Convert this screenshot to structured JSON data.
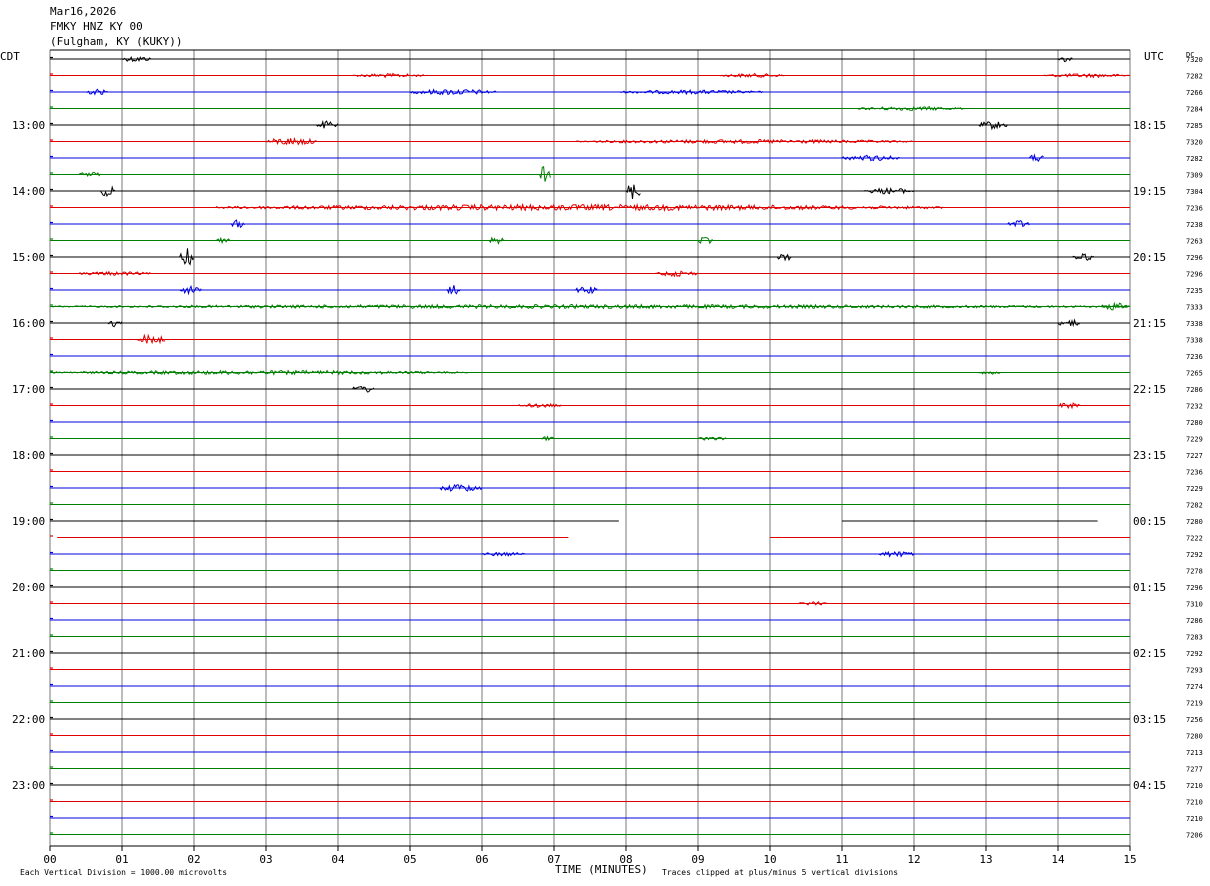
{
  "header": {
    "date": "Mar16,2026",
    "station": "FMKY HNZ KY 00",
    "site": "(Fulgham, KY (KUKY))"
  },
  "chart_data": {
    "type": "line",
    "subtype": "helicorder",
    "left_zone": "CDT",
    "right_zone": "UTC",
    "dc_label": "DC",
    "xlabel": "TIME (MINUTES)",
    "x_ticks": [
      "00",
      "01",
      "02",
      "03",
      "04",
      "05",
      "06",
      "07",
      "08",
      "09",
      "10",
      "11",
      "12",
      "13",
      "14",
      "15"
    ],
    "xlim": [
      0,
      15
    ],
    "scale_note": "Each Vertical Division = 1000.00 microvolts",
    "clip_note": "Traces clipped at plus/minus 5 vertical divisions",
    "trace_colors": [
      "#000000",
      "#e00000",
      "#0000e0",
      "#008000"
    ],
    "left_hour_labels": [
      {
        "row": 4,
        "label": "13:00"
      },
      {
        "row": 8,
        "label": "14:00"
      },
      {
        "row": 12,
        "label": "15:00"
      },
      {
        "row": 16,
        "label": "16:00"
      },
      {
        "row": 20,
        "label": "17:00"
      },
      {
        "row": 24,
        "label": "18:00"
      },
      {
        "row": 28,
        "label": "19:00"
      },
      {
        "row": 32,
        "label": "20:00"
      },
      {
        "row": 36,
        "label": "21:00"
      },
      {
        "row": 40,
        "label": "22:00"
      },
      {
        "row": 44,
        "label": "23:00"
      }
    ],
    "right_hour_labels": [
      {
        "row": 4,
        "label": "18:15"
      },
      {
        "row": 8,
        "label": "19:15"
      },
      {
        "row": 12,
        "label": "20:15"
      },
      {
        "row": 16,
        "label": "21:15"
      },
      {
        "row": 20,
        "label": "22:15"
      },
      {
        "row": 24,
        "label": "23:15"
      },
      {
        "row": 28,
        "label": "00:15"
      },
      {
        "row": 32,
        "label": "01:15"
      },
      {
        "row": 36,
        "label": "02:15"
      },
      {
        "row": 40,
        "label": "03:15"
      },
      {
        "row": 44,
        "label": "04:15"
      }
    ],
    "dc_values": [
      "7320",
      "7282",
      "7266",
      "7284",
      "7285",
      "7320",
      "7282",
      "7309",
      "7304",
      "7236",
      "7238",
      "7263",
      "7296",
      "7296",
      "7235",
      "7333",
      "7338",
      "7338",
      "7236",
      "7265",
      "7286",
      "7232",
      "7280",
      "7229",
      "7227",
      "7236",
      "7229",
      "7282",
      "7280",
      "7222",
      "7292",
      "7278",
      "7296",
      "7310",
      "7286",
      "7283",
      "7292",
      "7293",
      "7274",
      "7219",
      "7256",
      "7280",
      "7213",
      "7277",
      "7210",
      "7210",
      "7210",
      "7206"
    ],
    "trace_events": [
      {
        "row": 0,
        "x0": 1.0,
        "x1": 1.4,
        "amp": 3
      },
      {
        "row": 0,
        "x0": 14.0,
        "x1": 14.2,
        "amp": 3
      },
      {
        "row": 1,
        "x0": 4.2,
        "x1": 5.2,
        "amp": 2
      },
      {
        "row": 1,
        "x0": 9.3,
        "x1": 10.2,
        "amp": 2
      },
      {
        "row": 1,
        "x0": 13.8,
        "x1": 15.0,
        "amp": 2
      },
      {
        "row": 2,
        "x0": 0.5,
        "x1": 0.8,
        "amp": 3
      },
      {
        "row": 2,
        "x0": 5.0,
        "x1": 6.2,
        "amp": 3
      },
      {
        "row": 2,
        "x0": 7.9,
        "x1": 9.9,
        "amp": 2
      },
      {
        "row": 3,
        "x0": 11.2,
        "x1": 12.7,
        "amp": 2
      },
      {
        "row": 4,
        "x0": 3.7,
        "x1": 4.0,
        "amp": 4
      },
      {
        "row": 4,
        "x0": 12.9,
        "x1": 13.3,
        "amp": 4
      },
      {
        "row": 5,
        "x0": 3.0,
        "x1": 3.7,
        "amp": 4
      },
      {
        "row": 5,
        "x0": 7.3,
        "x1": 12.0,
        "amp": 2
      },
      {
        "row": 6,
        "x0": 11.0,
        "x1": 11.8,
        "amp": 3
      },
      {
        "row": 6,
        "x0": 13.6,
        "x1": 13.8,
        "amp": 4
      },
      {
        "row": 7,
        "x0": 0.4,
        "x1": 0.7,
        "amp": 3
      },
      {
        "row": 7,
        "x0": 6.8,
        "x1": 6.95,
        "amp": 9
      },
      {
        "row": 8,
        "x0": 0.7,
        "x1": 0.9,
        "amp": 6
      },
      {
        "row": 8,
        "x0": 8.0,
        "x1": 8.2,
        "amp": 9
      },
      {
        "row": 8,
        "x0": 11.3,
        "x1": 12.0,
        "amp": 3
      },
      {
        "row": 9,
        "x0": 2.3,
        "x1": 12.4,
        "amp": 3
      },
      {
        "row": 10,
        "x0": 2.5,
        "x1": 2.7,
        "amp": 4
      },
      {
        "row": 10,
        "x0": 13.3,
        "x1": 13.6,
        "amp": 4
      },
      {
        "row": 11,
        "x0": 2.3,
        "x1": 2.5,
        "amp": 3
      },
      {
        "row": 11,
        "x0": 6.1,
        "x1": 6.3,
        "amp": 4
      },
      {
        "row": 11,
        "x0": 9.0,
        "x1": 9.2,
        "amp": 4
      },
      {
        "row": 12,
        "x0": 1.8,
        "x1": 2.0,
        "amp": 9
      },
      {
        "row": 12,
        "x0": 10.1,
        "x1": 10.3,
        "amp": 4
      },
      {
        "row": 12,
        "x0": 14.2,
        "x1": 14.5,
        "amp": 4
      },
      {
        "row": 13,
        "x0": 0.4,
        "x1": 1.4,
        "amp": 2
      },
      {
        "row": 13,
        "x0": 8.4,
        "x1": 9.0,
        "amp": 3
      },
      {
        "row": 14,
        "x0": 1.8,
        "x1": 2.1,
        "amp": 4
      },
      {
        "row": 14,
        "x0": 5.5,
        "x1": 5.7,
        "amp": 5
      },
      {
        "row": 14,
        "x0": 7.3,
        "x1": 7.6,
        "amp": 4
      },
      {
        "row": 15,
        "x0": 0.0,
        "x1": 15.0,
        "amp": 2
      },
      {
        "row": 15,
        "x0": 14.6,
        "x1": 15.0,
        "amp": 4
      },
      {
        "row": 16,
        "x0": 0.8,
        "x1": 1.0,
        "amp": 4
      },
      {
        "row": 16,
        "x0": 14.0,
        "x1": 14.3,
        "amp": 4
      },
      {
        "row": 17,
        "x0": 1.2,
        "x1": 1.6,
        "amp": 5
      },
      {
        "row": 19,
        "x0": 0.0,
        "x1": 5.8,
        "amp": 2
      },
      {
        "row": 19,
        "x0": 12.9,
        "x1": 13.2,
        "amp": 2
      },
      {
        "row": 20,
        "x0": 4.2,
        "x1": 4.5,
        "amp": 4
      },
      {
        "row": 21,
        "x0": 6.5,
        "x1": 7.1,
        "amp": 2
      },
      {
        "row": 21,
        "x0": 14.0,
        "x1": 14.3,
        "amp": 3
      },
      {
        "row": 23,
        "x0": 6.8,
        "x1": 7.0,
        "amp": 2
      },
      {
        "row": 23,
        "x0": 9.0,
        "x1": 9.4,
        "amp": 2
      },
      {
        "row": 26,
        "x0": 5.4,
        "x1": 6.0,
        "amp": 4
      },
      {
        "row": 30,
        "x0": 6.0,
        "x1": 6.6,
        "amp": 2
      },
      {
        "row": 30,
        "x0": 11.5,
        "x1": 12.0,
        "amp": 3
      },
      {
        "row": 33,
        "x0": 10.4,
        "x1": 10.8,
        "amp": 2
      }
    ],
    "trace_gaps": [
      {
        "row": 28,
        "x0": 7.9,
        "x1": 11.0
      },
      {
        "row": 28,
        "x0": 14.55,
        "x1": 15.0
      },
      {
        "row": 29,
        "x0": 0.0,
        "x1": 0.1
      },
      {
        "row": 29,
        "x0": 7.2,
        "x1": 10.0
      }
    ]
  }
}
